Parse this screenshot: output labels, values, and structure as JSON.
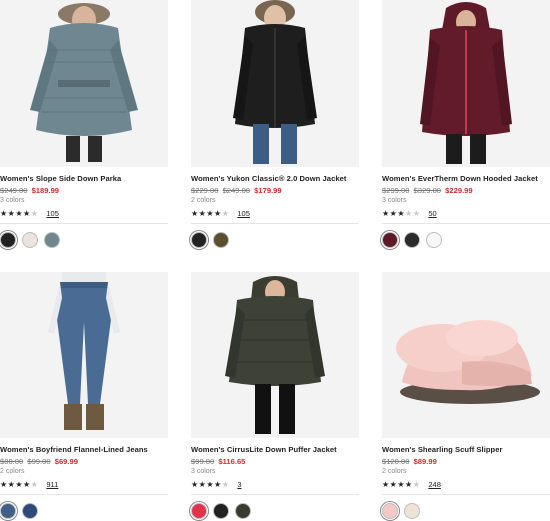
{
  "products": [
    {
      "name": "Women's Slope Side Down Parka",
      "prices_old": [
        "$249.00"
      ],
      "price_sale": "$189.99",
      "colors_text": "3 colors",
      "stars": "★★★★★",
      "rating": 4.5,
      "reviews": "105",
      "swatches": [
        "#222222",
        "#ece3dc",
        "#6f8790"
      ],
      "image_icon": "jacket-photo"
    },
    {
      "name": "Women's Yukon Classic® 2.0 Down Jacket",
      "prices_old": [
        "$229.00",
        "$249.00"
      ],
      "price_sale": "$179.99",
      "colors_text": "2 colors",
      "stars": "★★★★★",
      "rating": 4.5,
      "reviews": "105",
      "swatches": [
        "#222222",
        "#5a5030"
      ],
      "image_icon": "jacket-photo"
    },
    {
      "name": "Women's EverTherm Down Hooded Jacket",
      "prices_old": [
        "$299.00",
        "$329.00"
      ],
      "price_sale": "$229.99",
      "colors_text": "3 colors",
      "stars": "★★★★★",
      "rating": 3.5,
      "reviews": "50",
      "swatches": [
        "#5e1a26",
        "#2b2b2b",
        "#f7f7f7"
      ],
      "image_icon": "jacket-photo"
    },
    {
      "name": "Women's Boyfriend Flannel-Lined Jeans",
      "prices_old": [
        "$80.00",
        "$99.00"
      ],
      "price_sale": "$69.99",
      "colors_text": "2 colors",
      "stars": "★★★★★",
      "rating": 4.5,
      "reviews": "911",
      "swatches": [
        "#3f5f86",
        "#2e4a7a"
      ],
      "image_icon": "jeans-photo"
    },
    {
      "name": "Women's CirrusLite Down Puffer Jacket",
      "prices_old": [
        "$99.00"
      ],
      "price_sale": "$116.65",
      "colors_text": "3 colors",
      "stars": "★★★★★",
      "rating": 4.5,
      "reviews": "3",
      "swatches": [
        "#e1334b",
        "#222222",
        "#3a3a2f"
      ],
      "image_icon": "jacket-photo"
    },
    {
      "name": "Women's Shearling Scuff Slipper",
      "prices_old": [
        "$120.00"
      ],
      "price_sale": "$89.99",
      "colors_text": "2 colors",
      "stars": "★★★★★",
      "rating": 4.5,
      "reviews": "248",
      "swatches": [
        "#f2c9c4",
        "#efe3d6"
      ],
      "image_icon": "slipper-photo"
    }
  ],
  "colors": {
    "sale": "#d12b2b",
    "strike": "#777777",
    "muted": "#888888"
  }
}
